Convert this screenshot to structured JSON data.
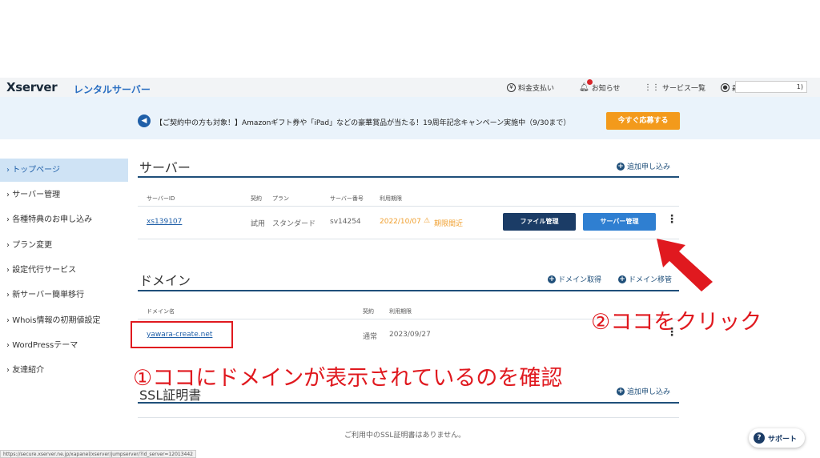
{
  "header": {
    "logo": "Xserver",
    "logo_sub": "レンタルサーバー",
    "nav": [
      {
        "label": "料金支払い",
        "icon": "yen-icon"
      },
      {
        "label": "お知らせ",
        "icon": "bell-icon"
      },
      {
        "label": "サービス一覧",
        "icon": "grid-icon"
      }
    ],
    "user_name": "森",
    "user_suffix": "1)"
  },
  "banner": {
    "text": "【ご契約中の方も対象！】Amazonギフト券や「iPad」などの豪華賞品が当たる！19周年記念キャンペーン実施中（9/30まで）",
    "button": "今すぐ応募する"
  },
  "sidebar": {
    "items": [
      {
        "label": "トップページ"
      },
      {
        "label": "サーバー管理"
      },
      {
        "label": "各種特典のお申し込み"
      },
      {
        "label": "プラン変更"
      },
      {
        "label": "設定代行サービス"
      },
      {
        "label": "新サーバー簡単移行"
      },
      {
        "label": "Whois情報の初期値設定"
      },
      {
        "label": "WordPressテーマ"
      },
      {
        "label": "友達紹介"
      }
    ]
  },
  "server": {
    "title": "サーバー",
    "add_link": "追加申し込み",
    "columns": [
      "サーバーID",
      "契約",
      "プラン",
      "サーバー番号",
      "利用期限"
    ],
    "row": {
      "id": "xs139107",
      "contract": "試用",
      "plan": "スタンダード",
      "number": "sv14254",
      "expiry": "2022/10/07",
      "warning": "期限間近",
      "file_button": "ファイル管理",
      "panel_button": "サーバー管理"
    }
  },
  "domain": {
    "title": "ドメイン",
    "link_acquire": "ドメイン取得",
    "link_transfer": "ドメイン移管",
    "columns": [
      "ドメイン名",
      "契約",
      "利用期限"
    ],
    "row": {
      "name": "yawara-create.net",
      "contract": "通常",
      "expiry": "2023/09/27"
    }
  },
  "ssl": {
    "title": "SSL証明書",
    "add_link": "追加申し込み",
    "empty": "ご利用中のSSL証明書はありません。"
  },
  "annotations": {
    "note1": "①ココにドメインが表示されているのを確認",
    "note2": "②ココをクリック"
  },
  "support": "サポート",
  "status_url": "https://secure.xserver.ne.jp/xapanel/xserver/jumpserver/?id_server=12013442",
  "colors": {
    "accent": "#1f4f7a",
    "annotation": "#e0191f",
    "banner_button": "#f39a1b"
  }
}
